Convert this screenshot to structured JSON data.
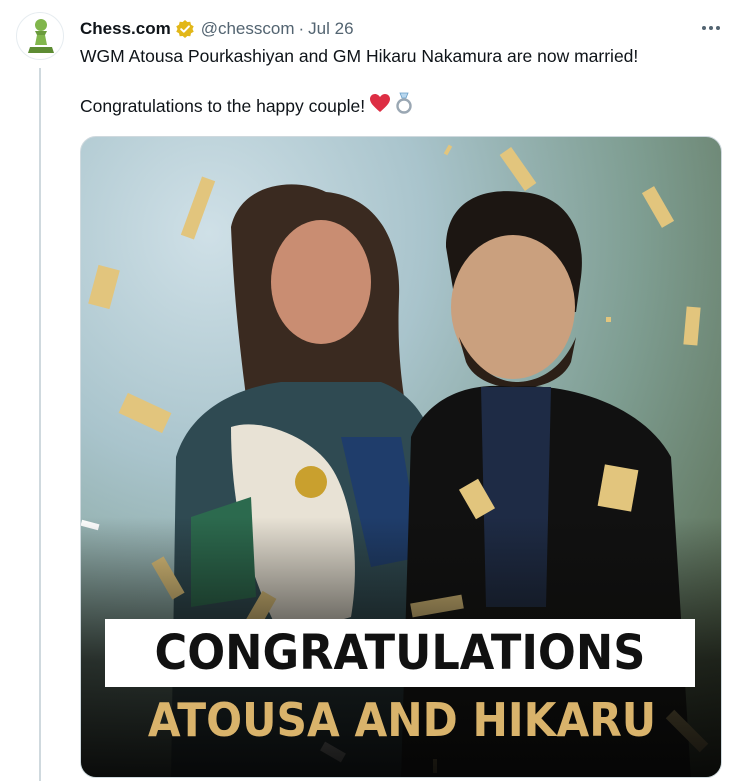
{
  "tweet": {
    "display_name": "Chess.com",
    "handle": "@chesscom",
    "separator": "·",
    "time": "Jul 26",
    "paragraph1": "WGM Atousa Pourkashiyan and GM Hikaru Nakamura are now married!",
    "paragraph2": "Congratulations to the happy couple!",
    "emojis": [
      "red-heart",
      "ring"
    ]
  },
  "media": {
    "banner_line1": "CONGRATULATIONS",
    "banner_line2": "ATOUSA AND HIKARU"
  },
  "icons": {
    "avatar": "chess-pawn-icon",
    "verified": "gold-verified-badge-icon",
    "more": "more-options-icon"
  },
  "colors": {
    "pawn_green": "#81b64c",
    "verified_gold": "#e2b719",
    "banner_gold": "#d9b36b",
    "handle_gray": "#536471",
    "heart_red": "#dd2e44"
  }
}
